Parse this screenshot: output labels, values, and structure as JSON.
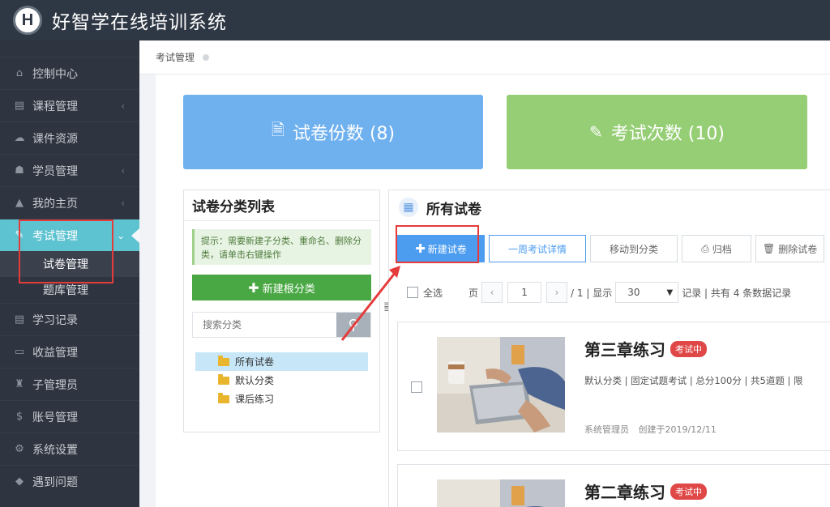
{
  "app": {
    "logo_letter": "H",
    "title": "好智学在线培训系统"
  },
  "sidebar": {
    "items": [
      {
        "label": "控制中心",
        "icon": "home-icon",
        "has_caret": false
      },
      {
        "label": "课程管理",
        "icon": "book-icon",
        "has_caret": true
      },
      {
        "label": "课件资源",
        "icon": "cloud-icon",
        "has_caret": false
      },
      {
        "label": "学员管理",
        "icon": "users-icon",
        "has_caret": true
      },
      {
        "label": "我的主页",
        "icon": "graduation-cap-icon",
        "has_caret": true
      },
      {
        "label": "考试管理",
        "icon": "pen-icon",
        "has_caret": true,
        "active": true
      }
    ],
    "subitems": [
      {
        "label": "试卷管理",
        "current": true
      },
      {
        "label": "题库管理",
        "current": false
      }
    ],
    "items_after": [
      {
        "label": "学习记录",
        "icon": "book-icon"
      },
      {
        "label": "收益管理",
        "icon": "card-icon"
      },
      {
        "label": "子管理员",
        "icon": "lock-icon"
      },
      {
        "label": "账号管理",
        "icon": "dollar-icon"
      },
      {
        "label": "系统设置",
        "icon": "gear-icon"
      },
      {
        "label": "遇到问题",
        "icon": "tag-icon"
      }
    ]
  },
  "breadcrumb": {
    "label": "考试管理"
  },
  "stats": {
    "papers": {
      "label": "试卷份数 (8)",
      "color": "#6fb0ef"
    },
    "exams": {
      "label": "考试次数 (10)",
      "color": "#96ce75"
    }
  },
  "category_panel": {
    "title": "试卷分类列表",
    "tip": "提示：需要新建子分类、重命名、删除分类，请单击右键操作",
    "new_root_label": "新建根分类",
    "search_placeholder": "搜索分类",
    "tree": [
      {
        "label": "所有试卷",
        "selected": true
      },
      {
        "label": "默认分类",
        "selected": false
      },
      {
        "label": "课后练习",
        "selected": false
      }
    ]
  },
  "exam_panel": {
    "title": "所有试卷",
    "toolbar": {
      "new_paper": "新建试卷",
      "weekly_details": "一周考试详情",
      "move_to_category": "移动到分类",
      "archive": "归档",
      "delete": "删除试卷"
    },
    "pager": {
      "select_all": "全选",
      "page_label": "页",
      "current_page": "1",
      "total_pages_text": "/ 1 | 显示",
      "page_size": "30",
      "record_summary": "记录 | 共有 4 条数据记录"
    },
    "cards": [
      {
        "title": "第三章练习",
        "status": "考试中",
        "meta": "默认分类 | 固定试题考试 | 总分100分 | 共5道题 | 限",
        "author": "系统管理员",
        "created": "创建于2019/12/11"
      },
      {
        "title": "第二章练习",
        "status": "考试中",
        "meta": "",
        "author": "",
        "created": ""
      }
    ]
  },
  "colors": {
    "topbar": "#2e3744",
    "sidebar": "#2f3540",
    "active": "#5dc3d1",
    "primary": "#4c9cf0",
    "success": "#4aa844",
    "danger": "#e04848",
    "highlight": "#e53b3b"
  }
}
